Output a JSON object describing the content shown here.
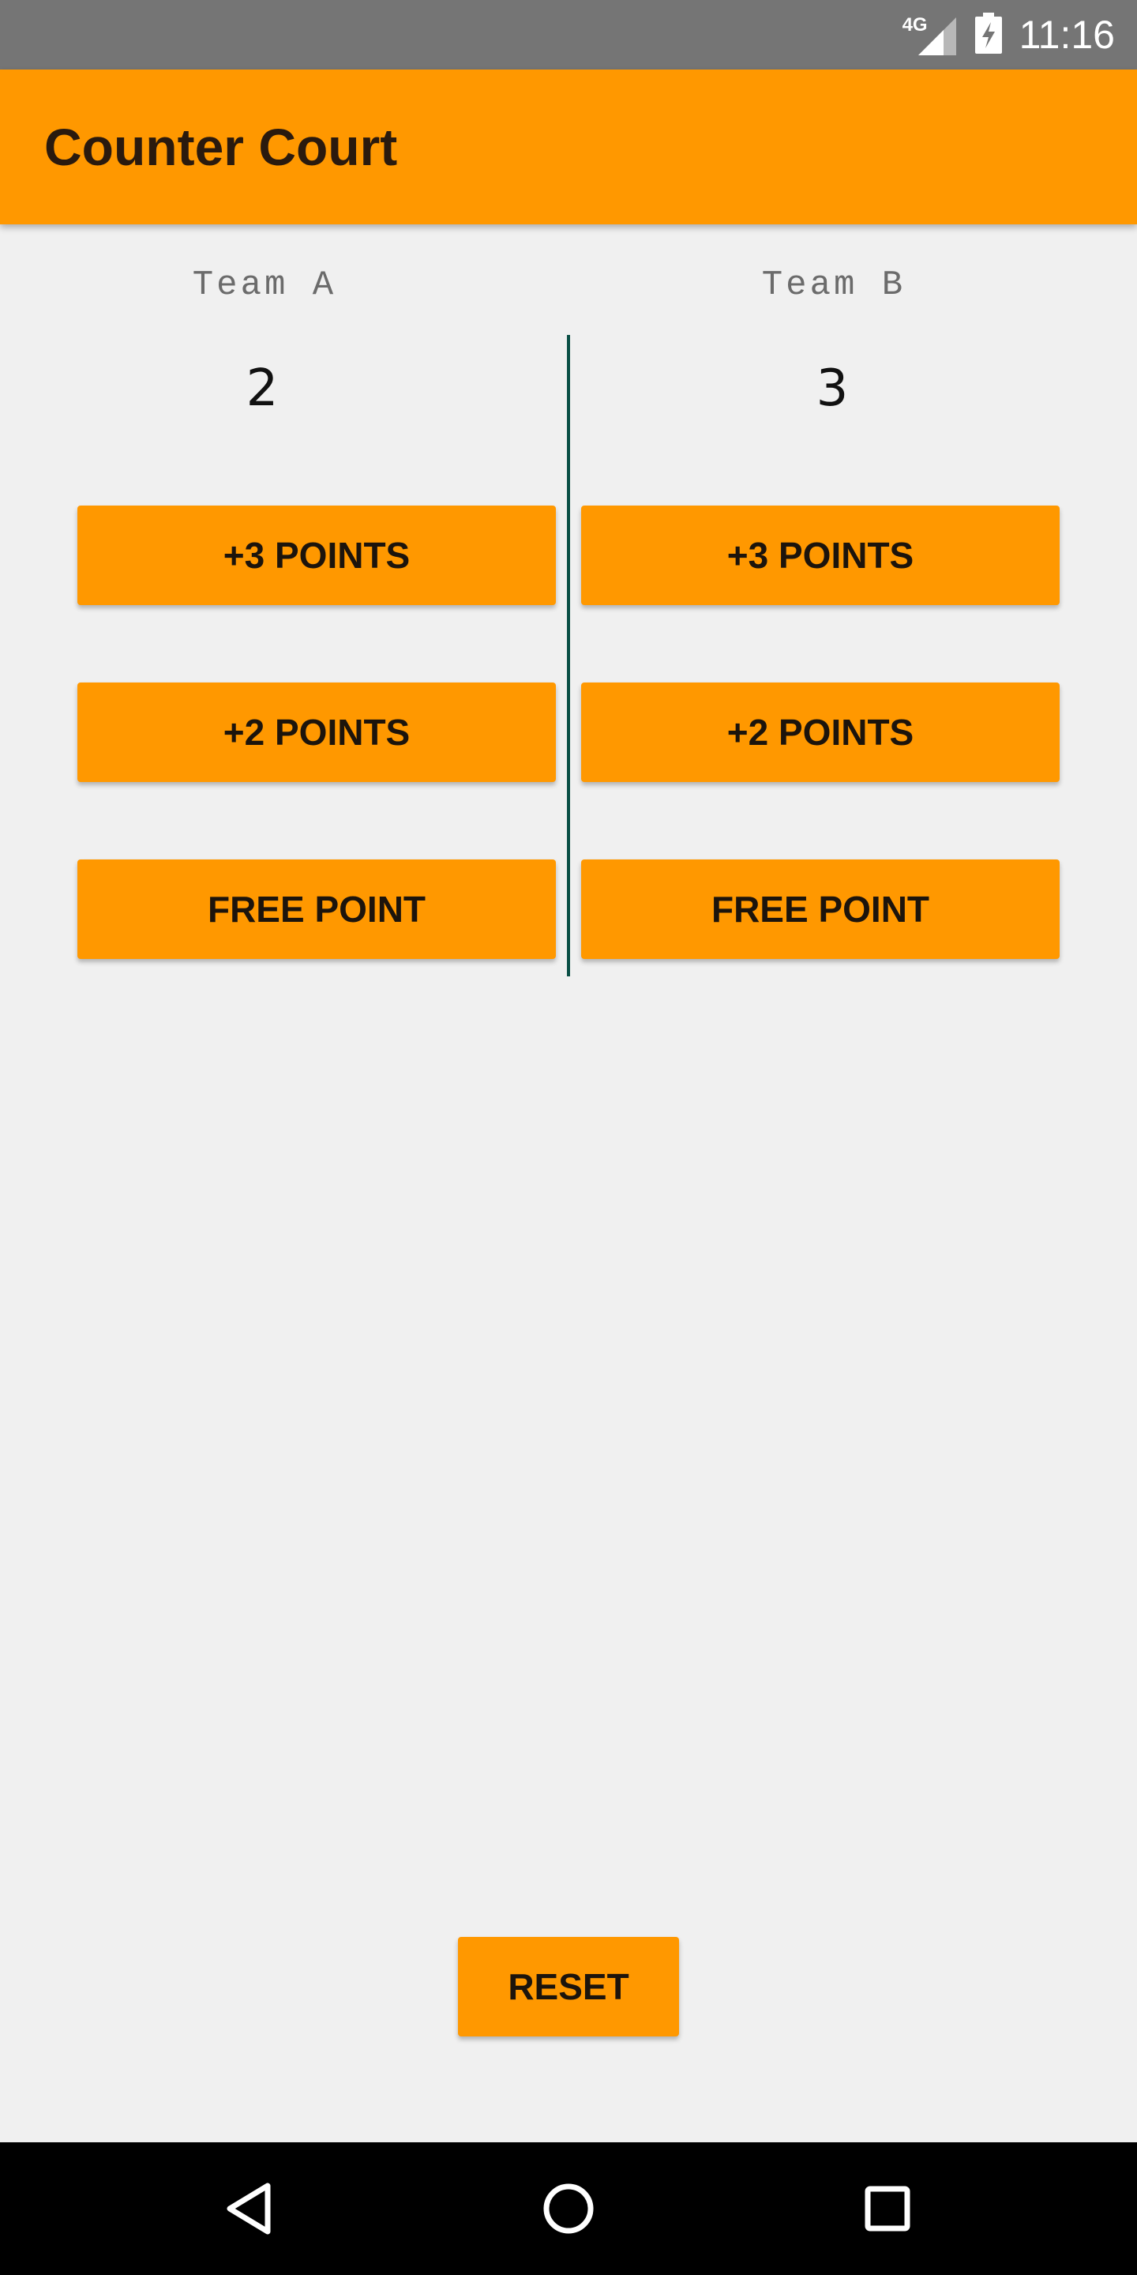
{
  "status_bar": {
    "network": "4G",
    "time": "11:16",
    "icons": [
      "signal-icon",
      "battery-charging-icon"
    ]
  },
  "app_bar": {
    "title": "Counter Court"
  },
  "teams": [
    {
      "name": "Team A",
      "score": "2"
    },
    {
      "name": "Team B",
      "score": "3"
    }
  ],
  "buttons": {
    "three_points": "+3 POINTS",
    "two_points": "+2 POINTS",
    "free_point": "FREE POINT",
    "reset": "RESET"
  },
  "nav_bar": {
    "icons": [
      "back-icon",
      "home-icon",
      "recents-icon"
    ]
  },
  "colors": {
    "accent": "#ff9800",
    "status_bar": "#757575",
    "divider": "#0a4f45",
    "background": "#f0f0f0"
  }
}
